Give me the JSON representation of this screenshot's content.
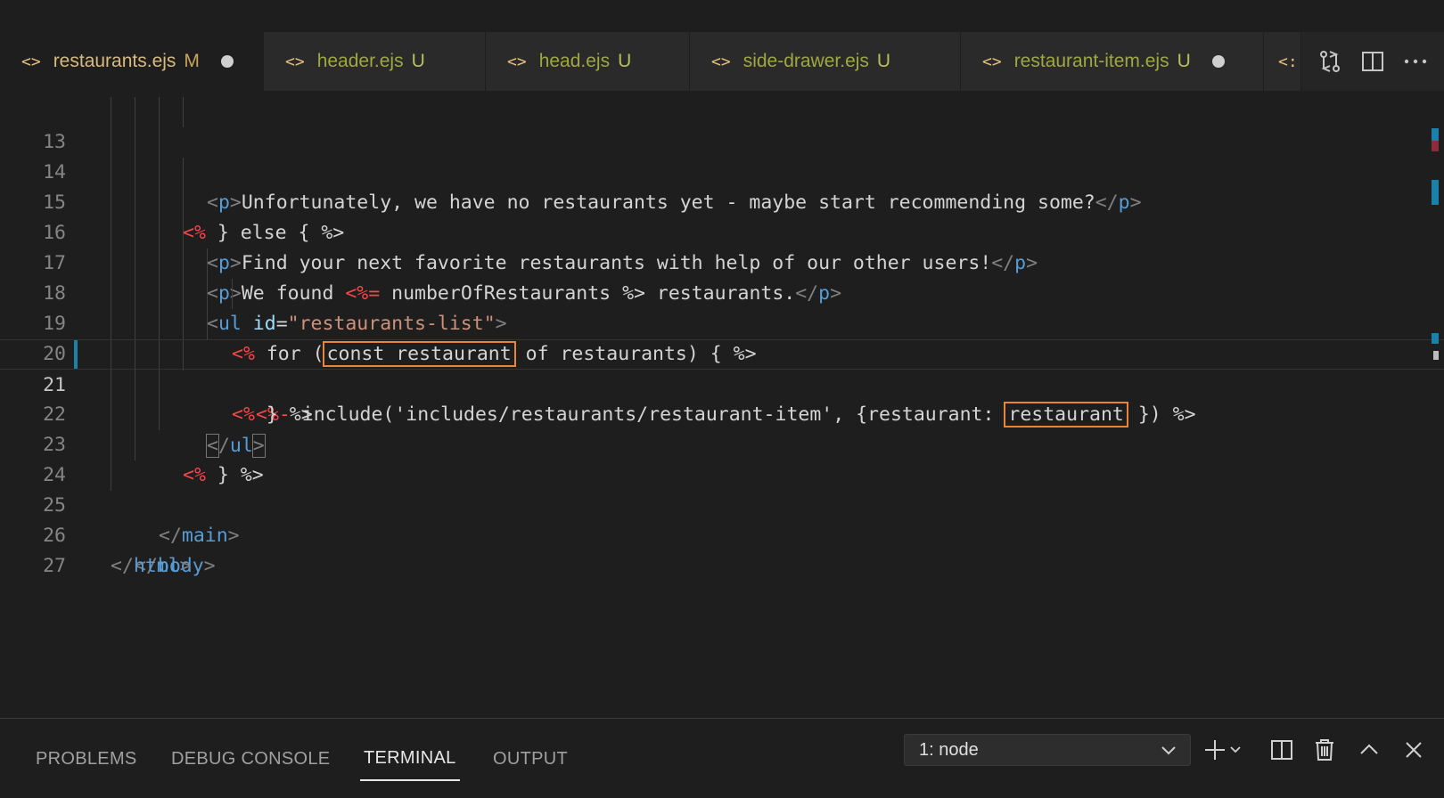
{
  "tabs": [
    {
      "name": "restaurants.ejs",
      "badge": "M",
      "dirty": true,
      "active": true
    },
    {
      "name": "header.ejs",
      "badge": "U"
    },
    {
      "name": "head.ejs",
      "badge": "U"
    },
    {
      "name": "side-drawer.ejs",
      "badge": "U"
    },
    {
      "name": "restaurant-item.ejs",
      "badge": "U",
      "dirty": true
    }
  ],
  "tab_overflow_icon": "<:",
  "editor": {
    "current_line": 21,
    "lines": [
      {
        "n": "13"
      },
      {
        "n": "14"
      },
      {
        "n": "15"
      },
      {
        "n": "16"
      },
      {
        "n": "17"
      },
      {
        "n": "18"
      },
      {
        "n": "19"
      },
      {
        "n": "20"
      },
      {
        "n": "21"
      },
      {
        "n": "22"
      },
      {
        "n": "23"
      },
      {
        "n": "24"
      },
      {
        "n": "25"
      },
      {
        "n": "26"
      },
      {
        "n": "27"
      }
    ],
    "l13_text": "Unfortunately, we have no restaurants yet - maybe start recommending some?",
    "l14_text": "} else {",
    "l15_text": "Find your next favorite restaurants with help of our other users!",
    "l16_a": "We found ",
    "l16_var": "numberOfRestaurants",
    "l16_b": " restaurants.",
    "l17_attr": "id",
    "l17_val": "\"restaurants-list\"",
    "l18_for": "for (",
    "l18_hl": "const restaurant",
    "l18_rest": "of restaurants) {",
    "l19_a": "include('includes/restaurants/restaurant-item', {restaurant:",
    "l19_hl": "restaurant",
    "l19_b": "})",
    "l20_text": "}",
    "l22_text": "}",
    "tag_p": "p",
    "tag_ul": "ul",
    "tag_main": "main",
    "tag_body": "body",
    "tag_html": "html",
    "ejs_open": "<%",
    "ejs_open_eq": "<%=",
    "ejs_open_dash": "<%-",
    "ejs_close": "%>"
  },
  "panel": {
    "tabs": [
      "PROBLEMS",
      "DEBUG CONSOLE",
      "TERMINAL",
      "OUTPUT"
    ],
    "active_tab": "TERMINAL",
    "terminal_select": "1: node"
  },
  "colors": {
    "highlight_box": "#e8853a",
    "modified_gutter": "#1b81a8"
  }
}
